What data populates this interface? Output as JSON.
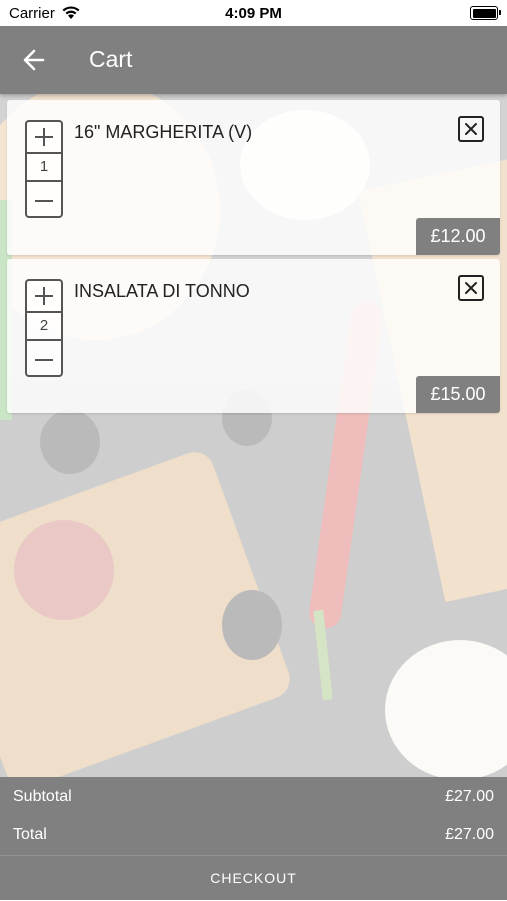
{
  "status_bar": {
    "carrier": "Carrier",
    "time": "4:09 PM",
    "wifi_icon": "wifi-icon",
    "battery_icon": "battery-icon"
  },
  "header": {
    "title": "Cart",
    "back_icon": "arrow-left-icon"
  },
  "cart": {
    "items": [
      {
        "name": "16\" MARGHERITA (V)",
        "quantity": "1",
        "price": "£12.00"
      },
      {
        "name": "INSALATA DI TONNO",
        "quantity": "2",
        "price": "£15.00"
      }
    ]
  },
  "summary": {
    "subtotal_label": "Subtotal",
    "subtotal_value": "£27.00",
    "total_label": "Total",
    "total_value": "£27.00",
    "checkout_label": "CHECKOUT"
  },
  "colors": {
    "bar_gray": "#808080",
    "text_dark": "#222222",
    "white": "#ffffff"
  }
}
